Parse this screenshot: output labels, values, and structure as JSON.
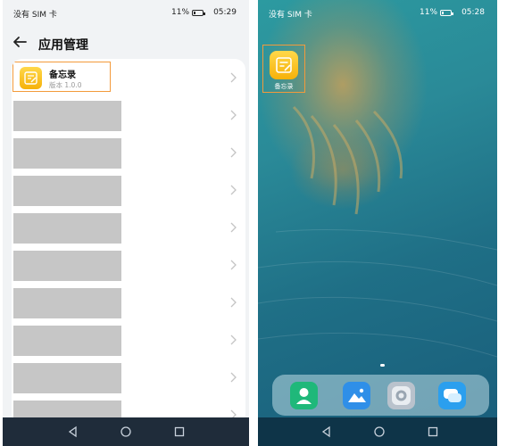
{
  "left_phone": {
    "status": {
      "carrier": "没有 SIM 卡",
      "battery": "11%",
      "battery_level": 0.11,
      "time": "05:29"
    },
    "title": "应用管理",
    "app_row": {
      "name": "备忘录",
      "version": "版本 1.0.0"
    },
    "redacted_rows": 8
  },
  "right_phone": {
    "status": {
      "carrier": "没有 SIM 卡",
      "battery": "11%",
      "battery_level": 0.11,
      "time": "05:28"
    },
    "home_app": {
      "label": "备忘录",
      "icon": "notepad-icon"
    },
    "dock": [
      {
        "name": "contacts",
        "icon": "contacts-icon",
        "color": "#1fb87a"
      },
      {
        "name": "gallery",
        "icon": "gallery-icon",
        "color": "#2f8fe8"
      },
      {
        "name": "camera",
        "icon": "camera-icon",
        "color": "#b9c2cc"
      },
      {
        "name": "messages",
        "icon": "messages-icon",
        "color": "#2b9fee"
      }
    ]
  },
  "colors": {
    "highlight": "#f39a3b",
    "app_icon": "#f7c21c"
  }
}
